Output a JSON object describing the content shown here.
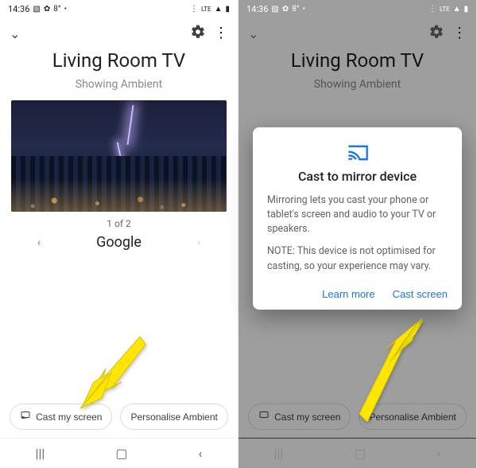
{
  "statusbar": {
    "time": "14:36",
    "left_icons": [
      "▧",
      "✿",
      "8°",
      "•"
    ],
    "right_icons": [
      "⋮",
      "LTE",
      "▲",
      "▮"
    ]
  },
  "header": {
    "back_icon": "chevron-down",
    "settings_icon": "gear",
    "overflow_icon": "more-vert"
  },
  "page": {
    "title": "Living Room TV",
    "subtitle": "Showing Ambient",
    "counter": "1 of 2",
    "carousel_label": "Google"
  },
  "buttons": {
    "cast_my_screen": "Cast my screen",
    "personalise_ambient": "Personalise Ambient"
  },
  "dialog": {
    "title": "Cast to mirror device",
    "body1": "Mirroring lets you cast your phone or tablet's screen and audio to your TV or speakers.",
    "body2": "NOTE: This device is not optimised for casting, so your experience may vary.",
    "learn_more": "Learn more",
    "cast_screen": "Cast screen"
  },
  "nav": {
    "recents": "|||",
    "home": "□",
    "back": "‹"
  },
  "colors": {
    "accent": "#1a73e8",
    "arrow": "#ffe600"
  }
}
